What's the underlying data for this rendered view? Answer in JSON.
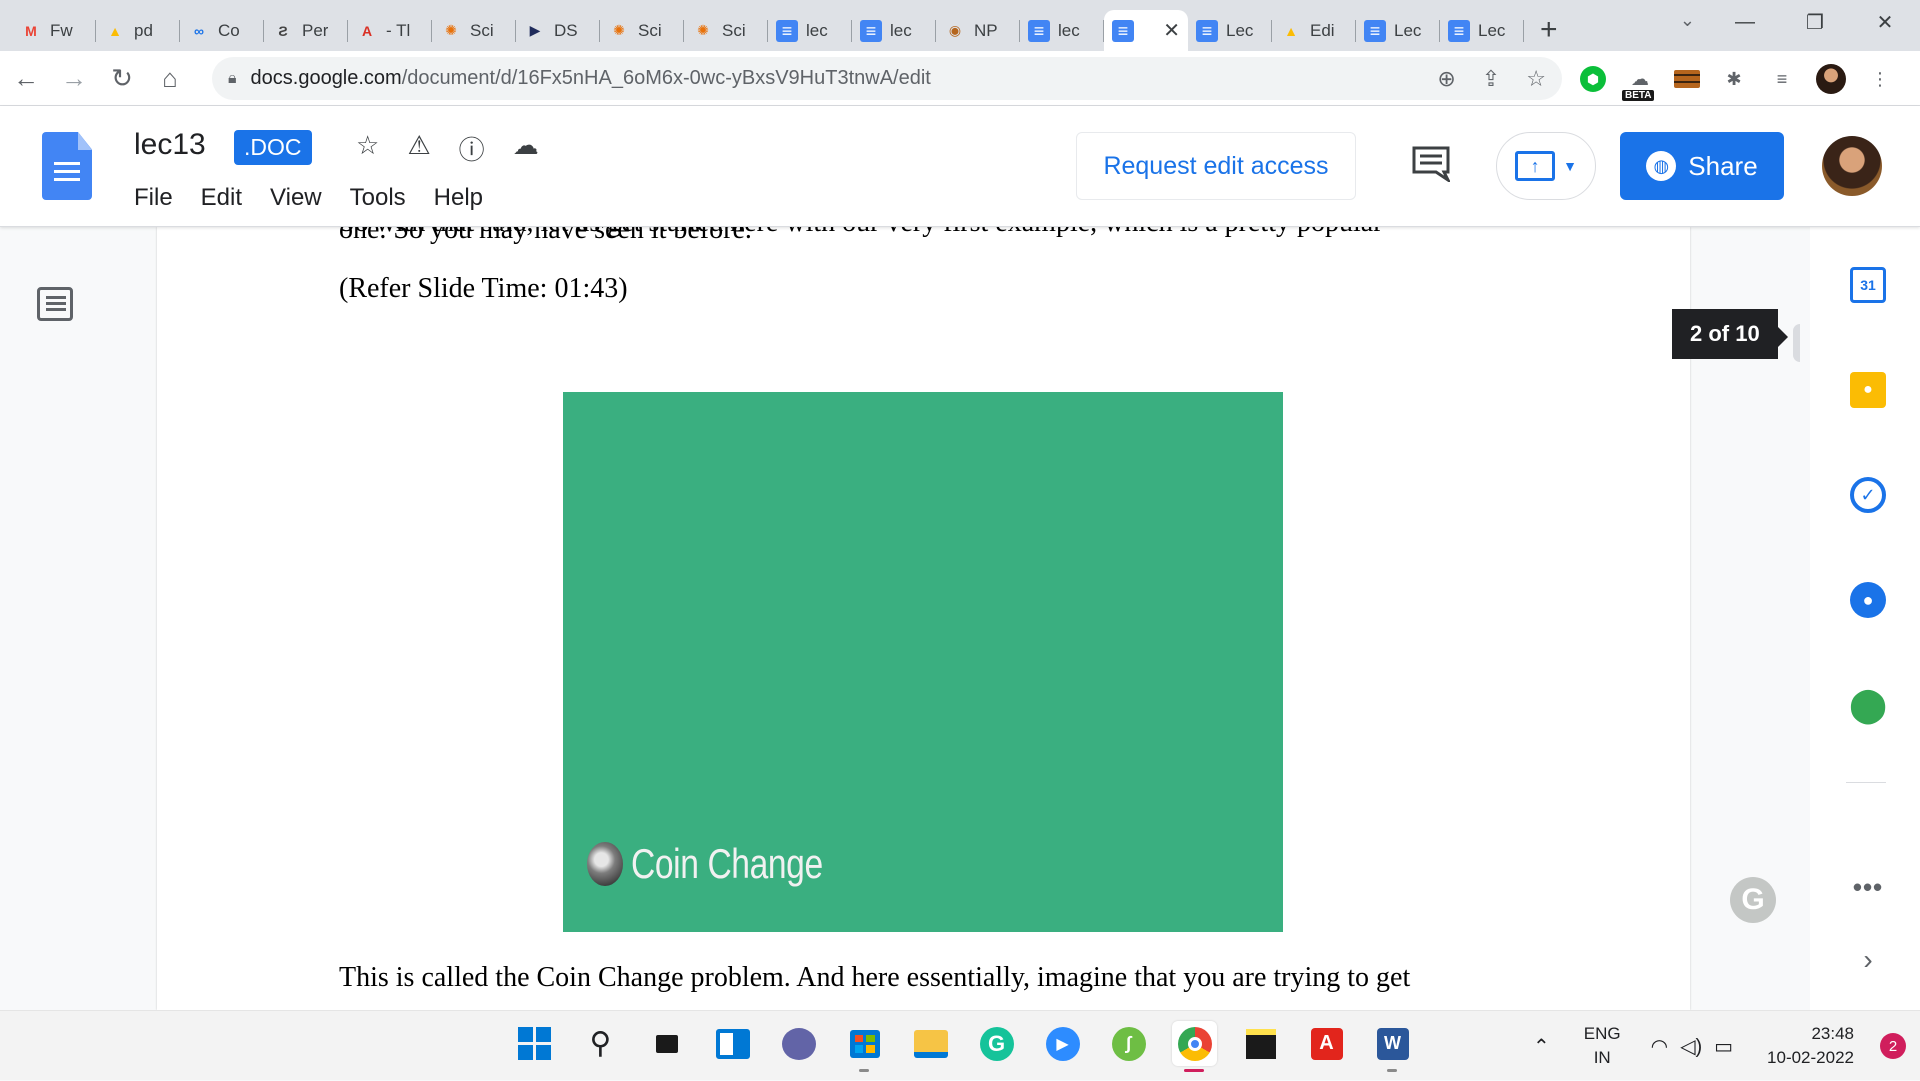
{
  "browser": {
    "tabs": [
      {
        "title": "Fw",
        "icon": "gmail-icon",
        "fav_text": "M",
        "fav_color": "#ea4335"
      },
      {
        "title": "pd",
        "icon": "drive-icon",
        "fav_text": "▲",
        "fav_color": "#fbbc04"
      },
      {
        "title": "Co",
        "icon": "link-icon",
        "fav_text": "∞",
        "fav_color": "#1a73e8"
      },
      {
        "title": "Per",
        "icon": "perplexity-icon",
        "fav_text": "Ƨ",
        "fav_color": "#444"
      },
      {
        "title": "- Tl",
        "icon": "acrobat-icon",
        "fav_text": "A",
        "fav_color": "#d93025"
      },
      {
        "title": "Sci",
        "icon": "scihub-icon",
        "fav_text": "✺",
        "fav_color": "#e8710a"
      },
      {
        "title": "DS",
        "icon": "ds-icon",
        "fav_text": "▶",
        "fav_color": "#1f2b5b"
      },
      {
        "title": "Sci",
        "icon": "scihub-icon",
        "fav_text": "✺",
        "fav_color": "#e8710a"
      },
      {
        "title": "Sci",
        "icon": "scihub-icon",
        "fav_text": "✺",
        "fav_color": "#e8710a"
      },
      {
        "title": "lec",
        "icon": "docs-icon",
        "fav_text": "",
        "fav_color": "#4285f4"
      },
      {
        "title": "lec",
        "icon": "docs-icon",
        "fav_text": "",
        "fav_color": "#4285f4"
      },
      {
        "title": "NP",
        "icon": "nptel-icon",
        "fav_text": "◉",
        "fav_color": "#b5651d"
      },
      {
        "title": "lec",
        "icon": "docs-icon",
        "fav_text": "",
        "fav_color": "#4285f4"
      },
      {
        "title": "",
        "icon": "docs-icon",
        "fav_text": "",
        "fav_color": "#4285f4",
        "active": true
      },
      {
        "title": "Lec",
        "icon": "docs-icon",
        "fav_text": "",
        "fav_color": "#4285f4"
      },
      {
        "title": "Edi",
        "icon": "drive-icon",
        "fav_text": "▲",
        "fav_color": "#fbbc04"
      },
      {
        "title": "Lec",
        "icon": "docs-icon",
        "fav_text": "",
        "fav_color": "#4285f4"
      },
      {
        "title": "Lec",
        "icon": "docs-icon",
        "fav_text": "",
        "fav_color": "#4285f4"
      }
    ],
    "close_glyph": "✕",
    "new_tab_glyph": "+",
    "url_host": "docs.google.com",
    "url_path": "/document/d/16Fx5nHA_6oM6x-0wc-yBxsV9HuT3tnwA/edit",
    "beta_label": "BETA"
  },
  "docs": {
    "title": "lec13",
    "badge": ".DOC",
    "menu": [
      "File",
      "Edit",
      "View",
      "Tools",
      "Help"
    ],
    "request_edit": "Request edit access",
    "share": "Share"
  },
  "document": {
    "cut_line": "So with that said, let us get started here with our very first example, which is a pretty popular",
    "line1": "one. So you may have seen it before.",
    "line2": "(Refer Slide Time: 01:43)",
    "slide_caption": "Coin Change",
    "line3": "This is called the Coin Change problem. And here essentially, imagine that you are trying to get",
    "slide_color": "#3aaf80"
  },
  "scroll_tip": "2 of 10",
  "side_panel": {
    "calendar_day": "31",
    "more": "•••",
    "chevron": "›"
  },
  "taskbar": {
    "lang_line1": "ENG",
    "lang_line2": "IN",
    "time": "23:48",
    "date": "10-02-2022",
    "notifications": "2"
  }
}
